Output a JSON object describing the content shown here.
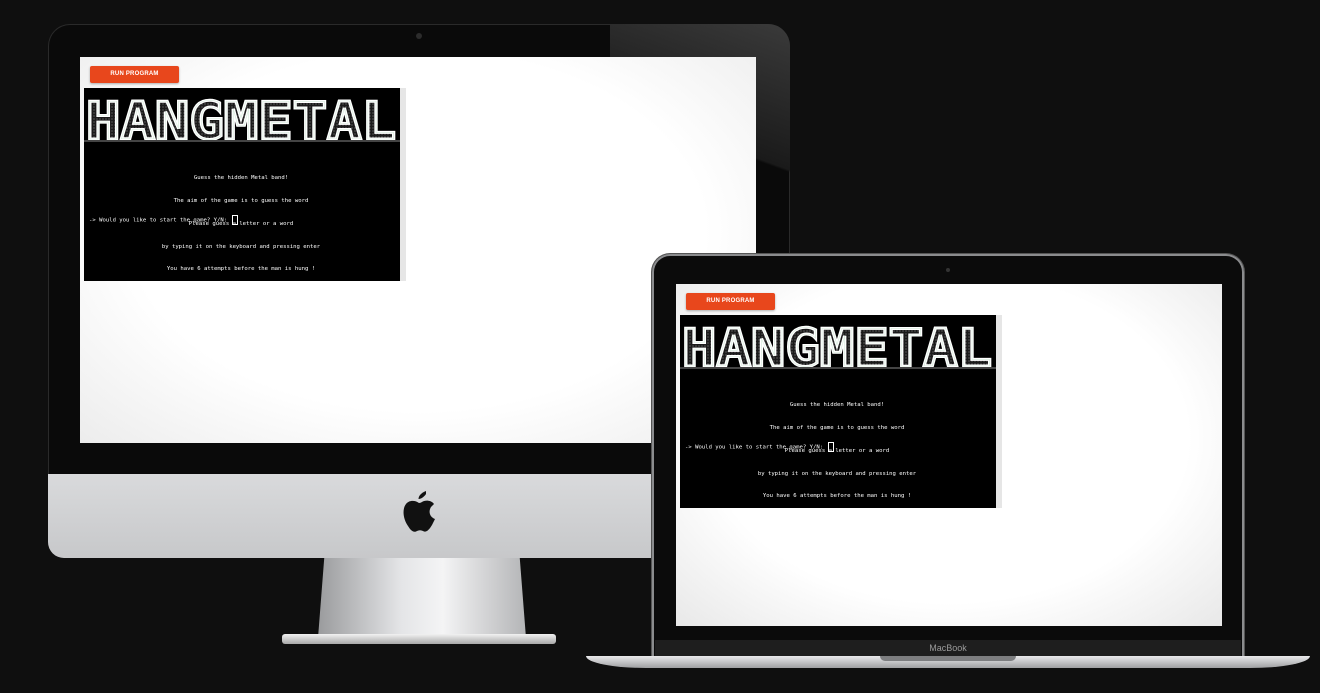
{
  "app": {
    "run_button_label": "RUN PROGRAM",
    "banner_text": "HANGMETAL",
    "intro_lines": [
      "Guess the hidden Metal band!",
      "The aim of the game is to guess the word",
      "Please guess a letter or a word",
      "by typing it on the keyboard and pressing enter",
      "You have 6 attempts before the man is hung !"
    ],
    "prompt": "-> Would you like to start the game? Y/N: "
  },
  "devices": {
    "laptop_brand": "MacBook",
    "desktop_logo": "apple-logo-icon"
  },
  "colors": {
    "run_button": "#e8471c",
    "terminal_bg": "#000000",
    "page_bg": "#0f0f0f"
  }
}
